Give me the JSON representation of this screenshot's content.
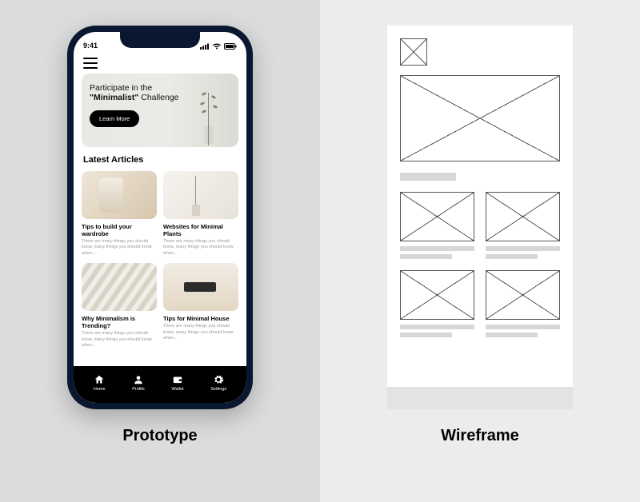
{
  "labels": {
    "prototype": "Prototype",
    "wireframe": "Wireframe"
  },
  "status": {
    "time": "9:41"
  },
  "hero": {
    "line1": "Participate in the",
    "line2_bold": "\"Minimalist\"",
    "line2_rest": " Challenge",
    "button": "Learn More"
  },
  "section_title": "Latest Articles",
  "article_desc": "There are many things you should know, many things you should know when...",
  "articles": [
    {
      "title": "Tips to build your wardrobe"
    },
    {
      "title": "Websites for Minimal Plants"
    },
    {
      "title": "Why Minimalism is Trending?"
    },
    {
      "title": "Tips for Minimal House"
    }
  ],
  "tabs": [
    {
      "label": "Home"
    },
    {
      "label": "Profile"
    },
    {
      "label": "Wallet"
    },
    {
      "label": "Settings"
    }
  ]
}
